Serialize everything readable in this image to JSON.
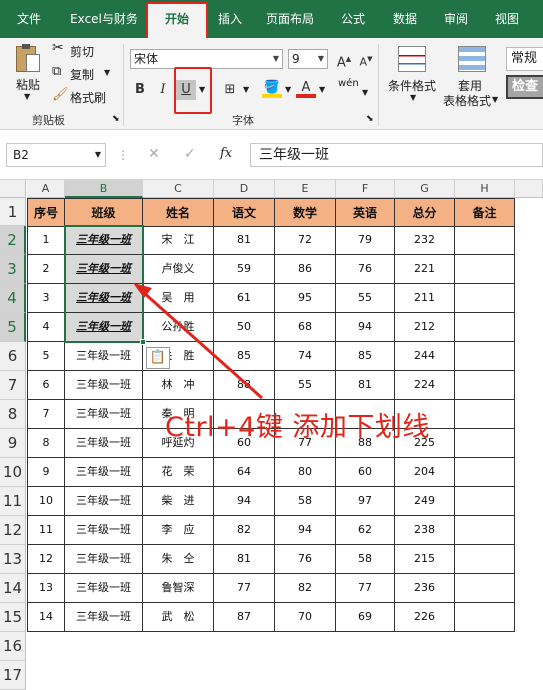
{
  "tabs": [
    "文件",
    "Excel与财务",
    "开始",
    "插入",
    "页面布局",
    "公式",
    "数据",
    "审阅",
    "视图"
  ],
  "active_tab": "开始",
  "ribbon": {
    "paste": "粘贴",
    "cut": "剪切",
    "copy": "复制",
    "format_painter": "格式刷",
    "clipboard_group": "剪贴板",
    "font_name": "宋体",
    "font_size": "9",
    "font_group": "字体",
    "bold": "B",
    "italic": "I",
    "underline": "U",
    "grow_font": "A",
    "shrink_font": "A",
    "font_color": "A",
    "phonetic": "wén",
    "conditional_format": "条件格式",
    "table_format": "套用",
    "table_format_2": "表格格式",
    "style_normal": "常规",
    "style_check": "检查"
  },
  "formula_bar": {
    "name_box": "B2",
    "fx": "fx",
    "content": "三年级一班"
  },
  "columns": [
    "A",
    "B",
    "C",
    "D",
    "E",
    "F",
    "G",
    "H"
  ],
  "rows": [
    "1",
    "2",
    "3",
    "4",
    "5",
    "6",
    "7",
    "8",
    "9",
    "10",
    "11",
    "12",
    "13",
    "14",
    "15",
    "16",
    "17"
  ],
  "headers": [
    "序号",
    "班级",
    "姓名",
    "语文",
    "数学",
    "英语",
    "总分",
    "备注"
  ],
  "data": [
    [
      "1",
      "三年级一班",
      "宋　江",
      "81",
      "72",
      "79",
      "232",
      ""
    ],
    [
      "2",
      "三年级一班",
      "卢俊义",
      "59",
      "86",
      "76",
      "221",
      ""
    ],
    [
      "3",
      "三年级一班",
      "吴　用",
      "61",
      "95",
      "55",
      "211",
      ""
    ],
    [
      "4",
      "三年级一班",
      "公孙胜",
      "50",
      "68",
      "94",
      "212",
      ""
    ],
    [
      "5",
      "三年级一班",
      "关　胜",
      "85",
      "74",
      "85",
      "244",
      ""
    ],
    [
      "6",
      "三年级一班",
      "林　冲",
      "88",
      "55",
      "81",
      "224",
      ""
    ],
    [
      "7",
      "三年级一班",
      "秦　明",
      "",
      "",
      "",
      "",
      ""
    ],
    [
      "8",
      "三年级一班",
      "呼延灼",
      "60",
      "77",
      "88",
      "225",
      ""
    ],
    [
      "9",
      "三年级一班",
      "花　荣",
      "64",
      "80",
      "60",
      "204",
      ""
    ],
    [
      "10",
      "三年级一班",
      "柴　进",
      "94",
      "58",
      "97",
      "249",
      ""
    ],
    [
      "11",
      "三年级一班",
      "李　应",
      "82",
      "94",
      "62",
      "238",
      ""
    ],
    [
      "12",
      "三年级一班",
      "朱　仝",
      "81",
      "76",
      "58",
      "215",
      ""
    ],
    [
      "13",
      "三年级一班",
      "鲁智深",
      "77",
      "82",
      "77",
      "236",
      ""
    ],
    [
      "14",
      "三年级一班",
      "武　松",
      "87",
      "70",
      "69",
      "226",
      ""
    ]
  ],
  "overlay_text": "Ctrl+4键 添加下划线",
  "colors": {
    "accent": "#217346",
    "header_fill": "#f4b183",
    "annotation": "#e0261c"
  }
}
